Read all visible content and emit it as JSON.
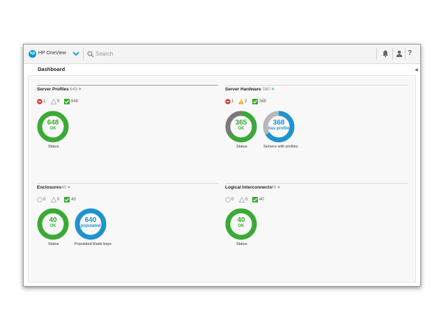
{
  "header": {
    "app_name": "HP OneView",
    "search_placeholder": "Search",
    "help_label": "?"
  },
  "page": {
    "title": "Dashboard"
  },
  "panels": {
    "server_profiles": {
      "title": "Server Profiles",
      "count": "649",
      "arrow": ">",
      "counts": {
        "critical": "1",
        "warning": "0",
        "ok": "648"
      },
      "donuts": [
        {
          "value": "648",
          "sub": "OK",
          "caption": "Status",
          "color": "#3aaa35"
        }
      ]
    },
    "server_hardware": {
      "title": "Server Hardware",
      "count": "560",
      "arrow": ">",
      "counts": {
        "critical": "1",
        "warning": "2",
        "ok": "365"
      },
      "donuts": [
        {
          "value": "365",
          "sub": "OK",
          "caption": "Status",
          "color": "#3aaa35",
          "fraction": 0.65,
          "remainder_color": "#7a7a7a"
        },
        {
          "value": "368",
          "sub": "has profile",
          "caption": "Servers with profiles",
          "color": "#1f93d1",
          "fraction": 0.66,
          "remainder_color": "#b8b8b8"
        }
      ]
    },
    "enclosures": {
      "title": "Enclosures",
      "count": "40",
      "arrow": ">",
      "counts": {
        "unknown": "0",
        "warning": "0",
        "ok": "40"
      },
      "donuts": [
        {
          "value": "40",
          "sub": "OK",
          "caption": "Status",
          "color": "#3aaa35"
        },
        {
          "value": "640",
          "sub": "populated",
          "caption": "Populated blade bays",
          "color": "#1f93d1"
        }
      ]
    },
    "logical_interconnects": {
      "title": "Logical Interconnects",
      "count": "40",
      "arrow": ">",
      "counts": {
        "unknown": "0",
        "warning": "0",
        "ok": "40"
      },
      "donuts": [
        {
          "value": "40",
          "sub": "OK",
          "caption": "Status",
          "color": "#3aaa35"
        }
      ]
    }
  },
  "colors": {
    "ok": "#3aaa35",
    "critical": "#d9342b",
    "warning": "#f0a30a",
    "link": "#0096d6",
    "profile": "#1f93d1"
  }
}
